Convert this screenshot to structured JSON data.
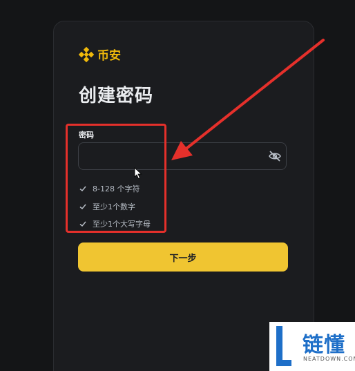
{
  "brand": {
    "name": "币安",
    "color": "#f0b90b",
    "logo_icon": "binance-diamond-icon"
  },
  "page": {
    "title": "创建密码"
  },
  "password_field": {
    "label": "密码",
    "value": "",
    "toggle_icon": "eye-slash-icon"
  },
  "requirements": [
    {
      "text": "8-128 个字符",
      "icon": "check-icon"
    },
    {
      "text": "至少1个数字",
      "icon": "check-icon"
    },
    {
      "text": "至少1个大写字母",
      "icon": "check-icon"
    }
  ],
  "next_button": {
    "label": "下一步",
    "color": "#f0c531"
  },
  "annotation": {
    "color": "#e5302b"
  },
  "watermark": {
    "name": "链懂",
    "domain": "NEATDOWN.COM"
  }
}
